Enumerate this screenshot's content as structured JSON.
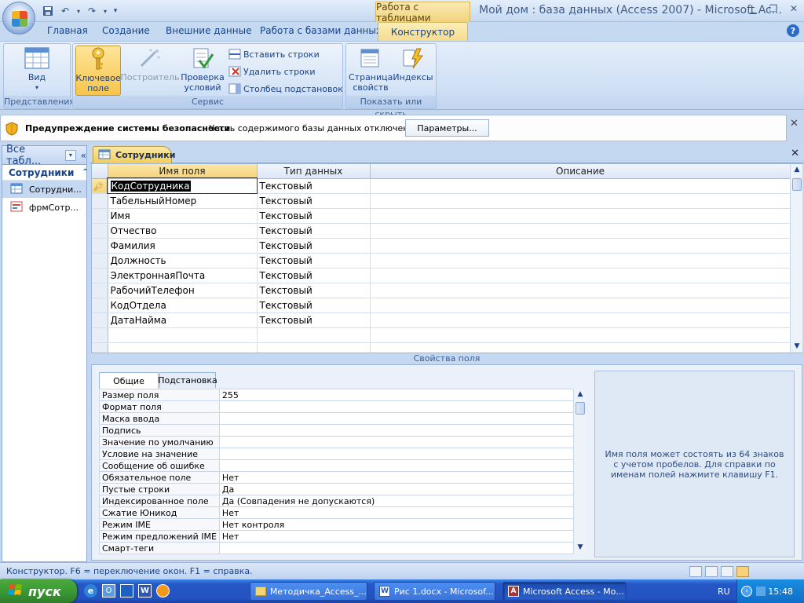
{
  "window": {
    "title": "Мой дом : база данных (Access 2007) - Microsoft Ac...",
    "context_tab_group": "Работа с таблицами",
    "controls": [
      "minimize",
      "restore",
      "close"
    ]
  },
  "ribbon": {
    "tabs": [
      "Главная",
      "Создание",
      "Внешние данные",
      "Работа с базами данных",
      "Конструктор"
    ],
    "active_tab": "Конструктор",
    "groups": {
      "views": {
        "label": "Представления",
        "view_button": "Вид"
      },
      "tools": {
        "label": "Сервис",
        "key_field": "Ключевое поле",
        "builder": "Построитель",
        "test_rules": "Проверка условий",
        "insert_rows": "Вставить строки",
        "delete_rows": "Удалить строки",
        "lookup_column": "Столбец  подстановок"
      },
      "show_hide": {
        "label": "Показать или скрыть",
        "property_sheet": "Страница свойств",
        "indexes": "Индексы"
      }
    }
  },
  "security_bar": {
    "title": "Предупреждение системы безопасности",
    "message": "Часть содержимого базы данных отключено",
    "options_button": "Параметры..."
  },
  "nav_pane": {
    "header": "Все табл...",
    "group": "Сотрудники",
    "items": [
      {
        "label": "Сотрудни...",
        "icon": "table-icon"
      },
      {
        "label": "фрмСотр...",
        "icon": "form-icon"
      }
    ]
  },
  "document_tab": "Сотрудники",
  "design_grid": {
    "headers": [
      "Имя поля",
      "Тип данных",
      "Описание"
    ],
    "rows": [
      {
        "name": "КодСотрудника",
        "type": "Текстовый",
        "desc": ""
      },
      {
        "name": "ТабельныйНомер",
        "type": "Текстовый",
        "desc": ""
      },
      {
        "name": "Имя",
        "type": "Текстовый",
        "desc": ""
      },
      {
        "name": "Отчество",
        "type": "Текстовый",
        "desc": ""
      },
      {
        "name": "Фамилия",
        "type": "Текстовый",
        "desc": ""
      },
      {
        "name": "Должность",
        "type": "Текстовый",
        "desc": ""
      },
      {
        "name": "ЭлектроннаяПочта",
        "type": "Текстовый",
        "desc": ""
      },
      {
        "name": "РабочийТелефон",
        "type": "Текстовый",
        "desc": ""
      },
      {
        "name": "КодОтдела",
        "type": "Текстовый",
        "desc": ""
      },
      {
        "name": "ДатаНайма",
        "type": "Текстовый",
        "desc": ""
      }
    ]
  },
  "field_properties": {
    "title": "Свойства поля",
    "tabs": [
      "Общие",
      "Подстановка"
    ],
    "active_tab": "Общие",
    "rows": [
      {
        "k": "Размер поля",
        "v": "255"
      },
      {
        "k": "Формат поля",
        "v": ""
      },
      {
        "k": "Маска ввода",
        "v": ""
      },
      {
        "k": "Подпись",
        "v": ""
      },
      {
        "k": "Значение по умолчанию",
        "v": ""
      },
      {
        "k": "Условие на значение",
        "v": ""
      },
      {
        "k": "Сообщение об ошибке",
        "v": ""
      },
      {
        "k": "Обязательное поле",
        "v": "Нет"
      },
      {
        "k": "Пустые строки",
        "v": "Да"
      },
      {
        "k": "Индексированное поле",
        "v": "Да (Совпадения не допускаются)"
      },
      {
        "k": "Сжатие Юникод",
        "v": "Нет"
      },
      {
        "k": "Режим IME",
        "v": "Нет контроля"
      },
      {
        "k": "Режим предложений IME",
        "v": "Нет"
      },
      {
        "k": "Смарт-теги",
        "v": ""
      }
    ],
    "help_text": "Имя поля может состоять из 64 знаков с учетом пробелов.  Для справки по именам полей нажмите клавишу F1."
  },
  "status_bar": {
    "text": "Конструктор.  F6 = переключение окон.  F1 = справка."
  },
  "taskbar": {
    "start": "пуск",
    "windows": [
      {
        "label": "Методичка_Access_...",
        "icon": "folder-icon",
        "active": false
      },
      {
        "label": "Рис 1.docx - Microsof...",
        "icon": "word-icon",
        "active": false
      },
      {
        "label": "Microsoft Access - Мо...",
        "icon": "access-icon",
        "active": true
      }
    ],
    "language": "RU",
    "clock": "15:48"
  },
  "colors": {
    "accent_tab": "#f5dc8e",
    "ribbon_bg": "#cfe0f5",
    "taskbar_blue": "#2453c1",
    "start_green": "#3a9a33"
  }
}
